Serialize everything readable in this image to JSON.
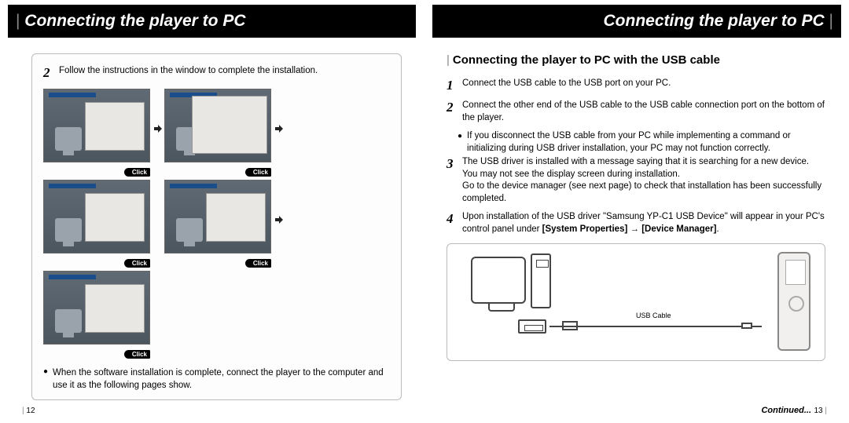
{
  "left": {
    "header": "Connecting the player to PC",
    "step2_num": "2",
    "step2_text": "Follow the instructions in the window to complete the installation.",
    "click_label": "Click",
    "footer_bullet": "●",
    "footer_text": "When the software installation is complete, connect the player to the computer and use it as the following pages show.",
    "page_num": "12"
  },
  "right": {
    "header": "Connecting the player to PC",
    "subhead_bar": "|",
    "subhead": "Connecting the player to PC with the USB cable",
    "steps": [
      {
        "num": "1",
        "text": "Connect the USB cable to the USB port on your PC."
      },
      {
        "num": "2",
        "text": "Connect the other end of the USB cable to the USB cable connection port on the bottom of the player."
      },
      {
        "num": "3",
        "text": "The USB driver is installed with a message saying that it is searching for a new device. You may not see the display screen during installation."
      },
      {
        "num": "4",
        "text": "Upon installation of the USB driver \"Samsung YP-C1 USB Device\" will appear in your PC's control panel under "
      }
    ],
    "step2_bullet": "●",
    "step2_bullet_text": "If you disconnect the USB cable from your PC while implementing a command or initializing during USB driver installation, your PC may not function correctly.",
    "step3_extra": "Go to the device manager (see next page) to check that installation has been successfully completed.",
    "step4_bold1": "[System Properties]",
    "step4_arrow": " → ",
    "step4_bold2": "[Device Manager]",
    "step4_period": ".",
    "usb_cable_label": "USB Cable",
    "continued": "Continued...",
    "page_num": "13"
  }
}
